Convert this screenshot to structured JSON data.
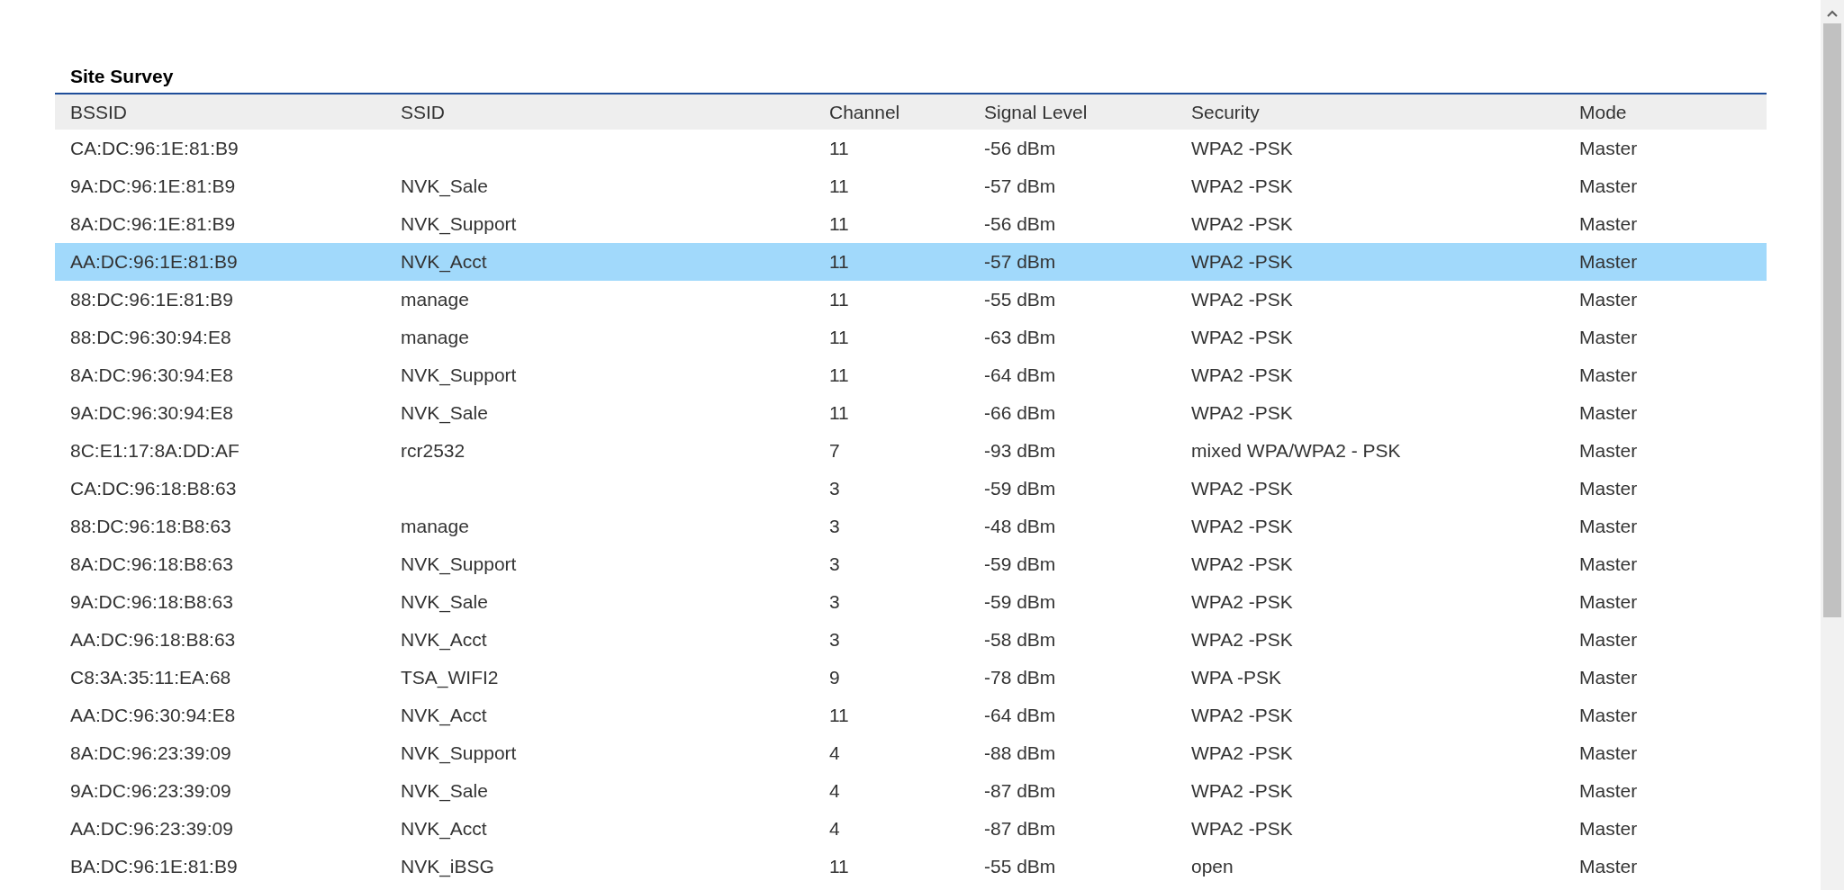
{
  "section": {
    "title": "Site Survey"
  },
  "table": {
    "columns": [
      "BSSID",
      "SSID",
      "Channel",
      "Signal Level",
      "Security",
      "Mode"
    ],
    "rows": [
      {
        "bssid": "CA:DC:96:1E:81:B9",
        "channel": "11",
        "signal_level": "-56 dBm",
        "security": "WPA2 -PSK",
        "mode": "Master",
        "selected": false
      },
      {
        "bssid": "9A:DC:96:1E:81:B9",
        "ssid": "NVK_Sale",
        "channel": "11",
        "signal_level": "-57 dBm",
        "security": "WPA2 -PSK",
        "mode": "Master",
        "selected": false
      },
      {
        "bssid": "8A:DC:96:1E:81:B9",
        "ssid": "NVK_Support",
        "channel": "11",
        "signal_level": "-56 dBm",
        "security": "WPA2 -PSK",
        "mode": "Master",
        "selected": false
      },
      {
        "bssid": "AA:DC:96:1E:81:B9",
        "ssid": "NVK_Acct",
        "channel": "11",
        "signal_level": "-57 dBm",
        "security": "WPA2 -PSK",
        "mode": "Master",
        "selected": true
      },
      {
        "bssid": "88:DC:96:1E:81:B9",
        "ssid": "manage",
        "channel": "11",
        "signal_level": "-55 dBm",
        "security": "WPA2 -PSK",
        "mode": "Master",
        "selected": false
      },
      {
        "bssid": "88:DC:96:30:94:E8",
        "ssid": "manage",
        "channel": "11",
        "signal_level": "-63 dBm",
        "security": "WPA2 -PSK",
        "mode": "Master",
        "selected": false
      },
      {
        "bssid": "8A:DC:96:30:94:E8",
        "ssid": "NVK_Support",
        "channel": "11",
        "signal_level": "-64 dBm",
        "security": "WPA2 -PSK",
        "mode": "Master",
        "selected": false
      },
      {
        "bssid": "9A:DC:96:30:94:E8",
        "ssid": "NVK_Sale",
        "channel": "11",
        "signal_level": "-66 dBm",
        "security": "WPA2 -PSK",
        "mode": "Master",
        "selected": false
      },
      {
        "bssid": "8C:E1:17:8A:DD:AF",
        "ssid": "rcr2532",
        "channel": "7",
        "signal_level": "-93 dBm",
        "security": "mixed WPA/WPA2 - PSK",
        "mode": "Master",
        "selected": false
      },
      {
        "bssid": "CA:DC:96:18:B8:63",
        "channel": "3",
        "signal_level": "-59 dBm",
        "security": "WPA2 -PSK",
        "mode": "Master",
        "selected": false
      },
      {
        "bssid": "88:DC:96:18:B8:63",
        "ssid": "manage",
        "channel": "3",
        "signal_level": "-48 dBm",
        "security": "WPA2 -PSK",
        "mode": "Master",
        "selected": false
      },
      {
        "bssid": "8A:DC:96:18:B8:63",
        "ssid": "NVK_Support",
        "channel": "3",
        "signal_level": "-59 dBm",
        "security": "WPA2 -PSK",
        "mode": "Master",
        "selected": false
      },
      {
        "bssid": "9A:DC:96:18:B8:63",
        "ssid": "NVK_Sale",
        "channel": "3",
        "signal_level": "-59 dBm",
        "security": "WPA2 -PSK",
        "mode": "Master",
        "selected": false
      },
      {
        "bssid": "AA:DC:96:18:B8:63",
        "ssid": "NVK_Acct",
        "channel": "3",
        "signal_level": "-58 dBm",
        "security": "WPA2 -PSK",
        "mode": "Master",
        "selected": false
      },
      {
        "bssid": "C8:3A:35:11:EA:68",
        "ssid": "TSA_WIFI2",
        "channel": "9",
        "signal_level": "-78 dBm",
        "security": "WPA -PSK",
        "mode": "Master",
        "selected": false
      },
      {
        "bssid": "AA:DC:96:30:94:E8",
        "ssid": "NVK_Acct",
        "channel": "11",
        "signal_level": "-64 dBm",
        "security": "WPA2 -PSK",
        "mode": "Master",
        "selected": false
      },
      {
        "bssid": "8A:DC:96:23:39:09",
        "ssid": "NVK_Support",
        "channel": "4",
        "signal_level": "-88 dBm",
        "security": "WPA2 -PSK",
        "mode": "Master",
        "selected": false
      },
      {
        "bssid": "9A:DC:96:23:39:09",
        "ssid": "NVK_Sale",
        "channel": "4",
        "signal_level": "-87 dBm",
        "security": "WPA2 -PSK",
        "mode": "Master",
        "selected": false
      },
      {
        "bssid": "AA:DC:96:23:39:09",
        "ssid": "NVK_Acct",
        "channel": "4",
        "signal_level": "-87 dBm",
        "security": "WPA2 -PSK",
        "mode": "Master",
        "selected": false
      },
      {
        "bssid": "BA:DC:96:1E:81:B9",
        "ssid": "NVK_iBSG",
        "channel": "11",
        "signal_level": "-55 dBm",
        "security": "open",
        "mode": "Master",
        "selected": false
      }
    ]
  }
}
